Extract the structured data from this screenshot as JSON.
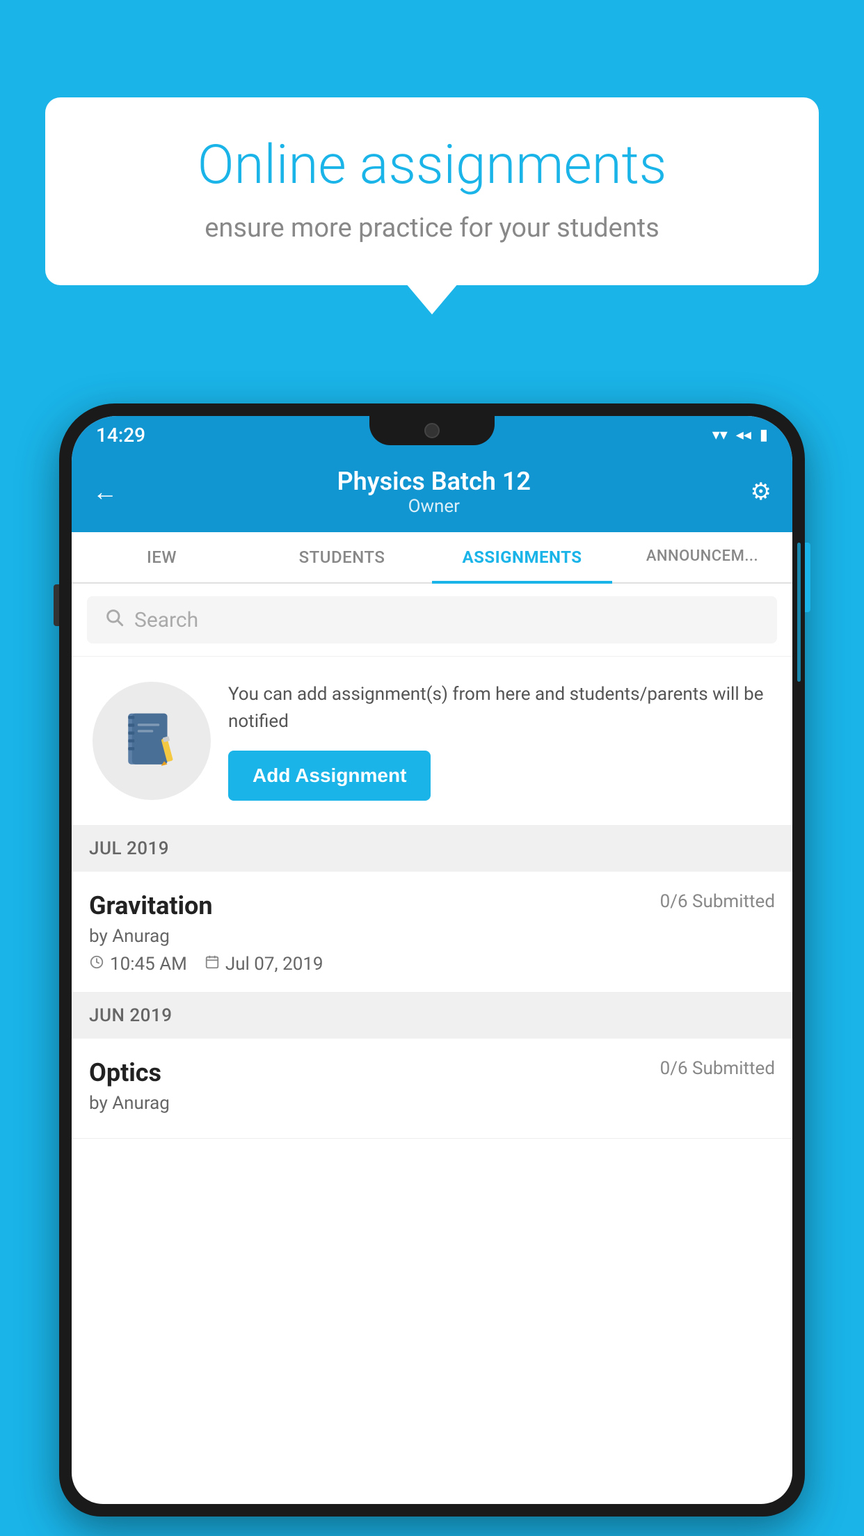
{
  "background": {
    "color": "#1ab4e8"
  },
  "speech_bubble": {
    "title": "Online assignments",
    "subtitle": "ensure more practice for your students"
  },
  "status_bar": {
    "time": "14:29",
    "wifi_icon": "▼",
    "signal_icon": "◀",
    "battery_icon": "▮"
  },
  "header": {
    "title": "Physics Batch 12",
    "subtitle": "Owner",
    "back_icon": "←",
    "settings_icon": "⚙"
  },
  "tabs": [
    {
      "label": "IEW",
      "active": false
    },
    {
      "label": "STUDENTS",
      "active": false
    },
    {
      "label": "ASSIGNMENTS",
      "active": true
    },
    {
      "label": "ANNOUNCEM...",
      "active": false
    }
  ],
  "search": {
    "placeholder": "Search"
  },
  "promo": {
    "description": "You can add assignment(s) from here and students/parents will be notified",
    "button_label": "Add Assignment"
  },
  "sections": [
    {
      "month": "JUL 2019",
      "assignments": [
        {
          "name": "Gravitation",
          "status": "0/6 Submitted",
          "author": "by Anurag",
          "time": "10:45 AM",
          "date": "Jul 07, 2019"
        }
      ]
    },
    {
      "month": "JUN 2019",
      "assignments": [
        {
          "name": "Optics",
          "status": "0/6 Submitted",
          "author": "by Anurag",
          "time": "",
          "date": ""
        }
      ]
    }
  ]
}
